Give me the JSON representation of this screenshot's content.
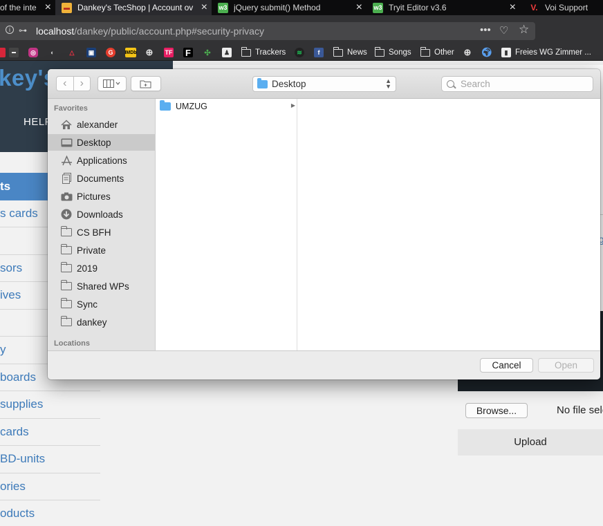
{
  "browser": {
    "tabs": [
      {
        "title": "of the inte",
        "icon": "tab-favicon-partial"
      },
      {
        "title": "Dankey's TecShop | Account ov",
        "icon": "dankey-favicon"
      },
      {
        "title": "jQuery submit() Method",
        "icon": "w3schools-favicon"
      },
      {
        "title": "Tryit Editor v3.6",
        "icon": "w3schools-favicon"
      },
      {
        "title": "Voi Support",
        "icon": "voi-favicon"
      }
    ],
    "url_prefix": "localhost",
    "url_path": "/dankey/public/account.php#security-privacy",
    "url_actions": [
      "more-icon",
      "pocket-icon",
      "star-icon"
    ],
    "bookmarks": {
      "folders": [
        "Trackers",
        "News",
        "Songs",
        "Other"
      ],
      "last": "Freies WG Zimmer ..."
    }
  },
  "page": {
    "brand": "key's TecSh",
    "help_link": "HELP",
    "categories": [
      "ts",
      "s cards",
      "",
      "sors",
      "ives",
      "",
      "y",
      "boards",
      "supplies",
      "cards",
      "BD-units",
      "ories",
      "oducts"
    ],
    "right_glyph": "g",
    "browse_button": "Browse...",
    "no_file_text": "No file sele",
    "upload_button": "Upload"
  },
  "dialog": {
    "location": "Desktop",
    "search_placeholder": "Search",
    "sidebar": {
      "favorites_header": "Favorites",
      "items": [
        {
          "label": "alexander",
          "icon": "home-icon"
        },
        {
          "label": "Desktop",
          "icon": "desktop-icon"
        },
        {
          "label": "Applications",
          "icon": "applications-icon"
        },
        {
          "label": "Documents",
          "icon": "documents-icon"
        },
        {
          "label": "Pictures",
          "icon": "camera-icon"
        },
        {
          "label": "Downloads",
          "icon": "download-icon"
        },
        {
          "label": "CS BFH",
          "icon": "folder-icon"
        },
        {
          "label": "Private",
          "icon": "folder-icon"
        },
        {
          "label": "2019",
          "icon": "folder-icon"
        },
        {
          "label": "Shared WPs",
          "icon": "folder-icon"
        },
        {
          "label": "Sync",
          "icon": "folder-icon"
        },
        {
          "label": "dankey",
          "icon": "folder-icon"
        }
      ],
      "locations_header": "Locations"
    },
    "files": [
      {
        "name": "UMZUG",
        "type": "folder"
      }
    ],
    "cancel_button": "Cancel",
    "open_button": "Open"
  }
}
